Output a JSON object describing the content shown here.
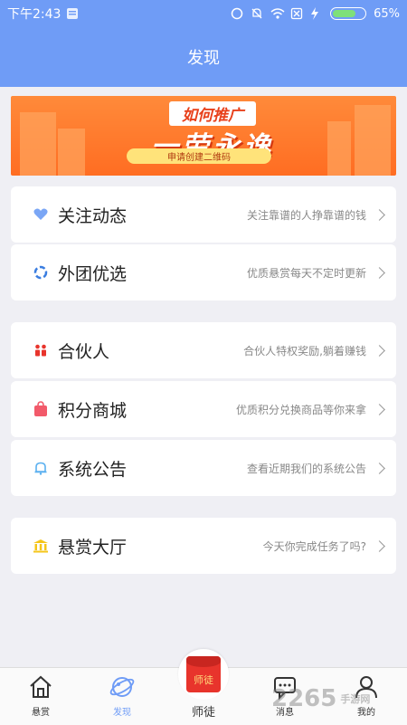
{
  "status_bar": {
    "time": "下午2:43",
    "battery": "65%",
    "battery_level": 0.65
  },
  "header": {
    "title": "发现"
  },
  "banner": {
    "top_text": "如何推广",
    "main_text": "一劳永逸",
    "sub_text": "申请创建二维码"
  },
  "menu_groups": [
    [
      {
        "label": "关注动态",
        "desc": "关注靠谱的人挣靠谱的钱",
        "icon": "heart-icon",
        "color": "#7aa6f5"
      },
      {
        "label": "外团优选",
        "desc": "优质悬赏每天不定时更新",
        "icon": "ring-icon",
        "color": "#3a7de0"
      }
    ],
    [
      {
        "label": "合伙人",
        "desc": "合伙人特权奖励,躺着赚钱",
        "icon": "partners-icon",
        "color": "#e8342c"
      },
      {
        "label": "积分商城",
        "desc": "优质积分兑换商品等你来拿",
        "icon": "bag-icon",
        "color": "#f25a6a"
      },
      {
        "label": "系统公告",
        "desc": "查看近期我们的系统公告",
        "icon": "bell-icon",
        "color": "#5ab0f0"
      }
    ],
    [
      {
        "label": "悬赏大厅",
        "desc": "今天你完成任务了吗?",
        "icon": "bank-icon",
        "color": "#f5c518"
      }
    ]
  ],
  "tabs": [
    {
      "label": "悬赏",
      "icon": "home-icon"
    },
    {
      "label": "发现",
      "icon": "planet-icon",
      "active": true
    },
    {
      "label": "师徒",
      "icon": "red-envelope-icon",
      "badge": "师徒"
    },
    {
      "label": "消息",
      "icon": "message-icon"
    },
    {
      "label": "我的",
      "icon": "user-icon"
    }
  ],
  "watermark": {
    "text": "2265",
    "suffix": "手游网"
  }
}
